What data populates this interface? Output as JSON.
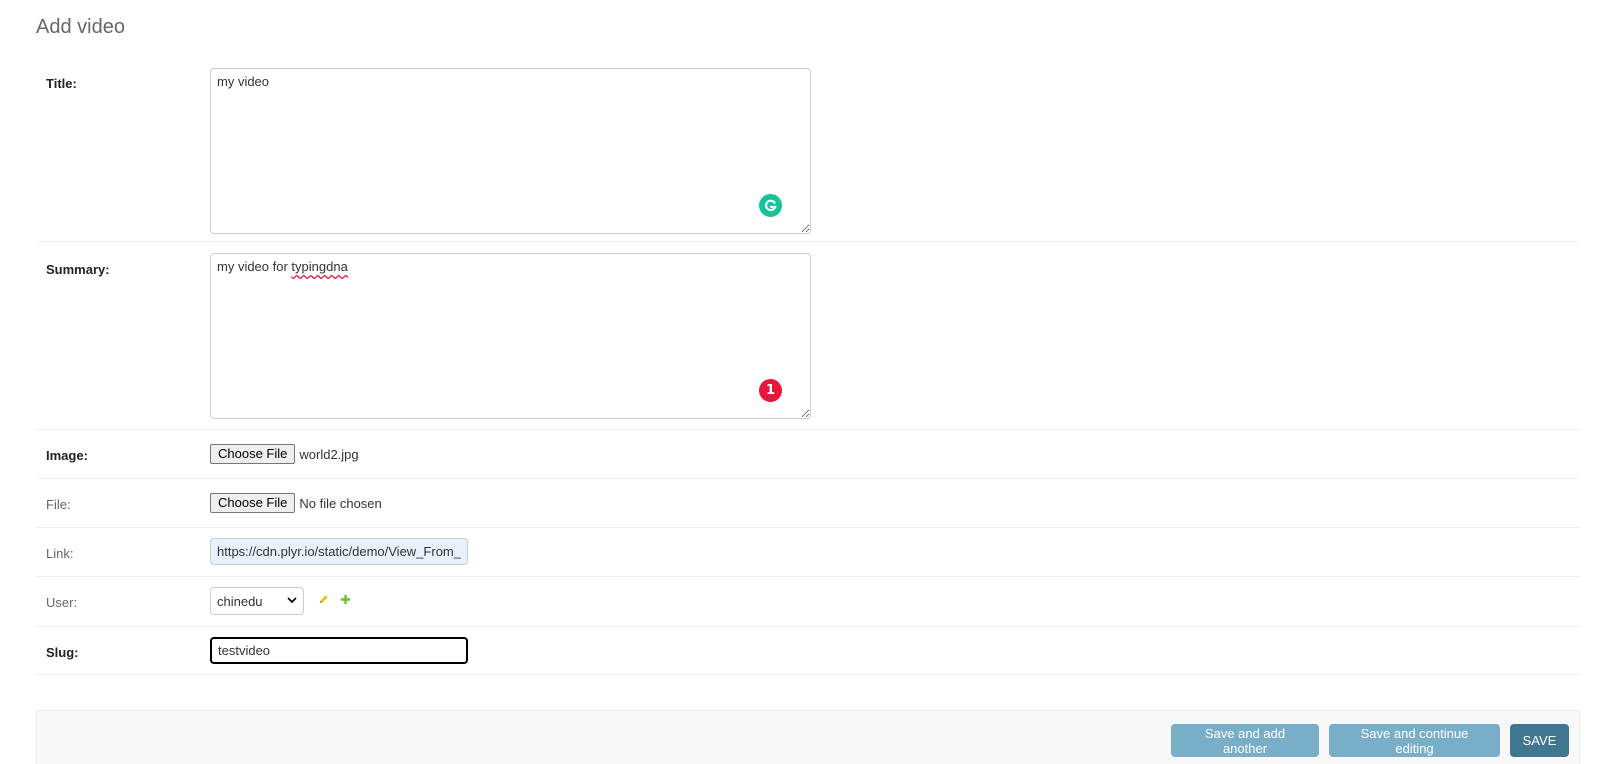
{
  "page": {
    "title": "Add video"
  },
  "fields": {
    "title": {
      "label": "Title:",
      "value": "my video",
      "badge_icon": "grammarly-icon"
    },
    "summary": {
      "label": "Summary:",
      "value_prefix": "my video for ",
      "value_misspelled": "typingdna",
      "error_count": "1"
    },
    "image": {
      "label": "Image:",
      "button_label": "Choose File",
      "file_name": "world2.jpg"
    },
    "file": {
      "label": "File:",
      "button_label": "Choose File",
      "file_name": "No file chosen"
    },
    "link": {
      "label": "Link:",
      "value": "https://cdn.plyr.io/static/demo/View_From_A"
    },
    "user": {
      "label": "User:",
      "selected": "chinedu",
      "edit_icon": "pencil-icon",
      "add_icon": "plus-icon"
    },
    "slug": {
      "label": "Slug:",
      "value": "testvideo"
    }
  },
  "actions": {
    "save_add_another": "Save and add another",
    "save_continue": "Save and continue editing",
    "save": "SAVE"
  },
  "colors": {
    "primary_button": "#417690",
    "secondary_button": "#79aec8",
    "grammarly": "#15c39a",
    "error_badge": "#e8153d",
    "edit_icon": "#efb80b",
    "add_icon": "#70bf2b"
  }
}
